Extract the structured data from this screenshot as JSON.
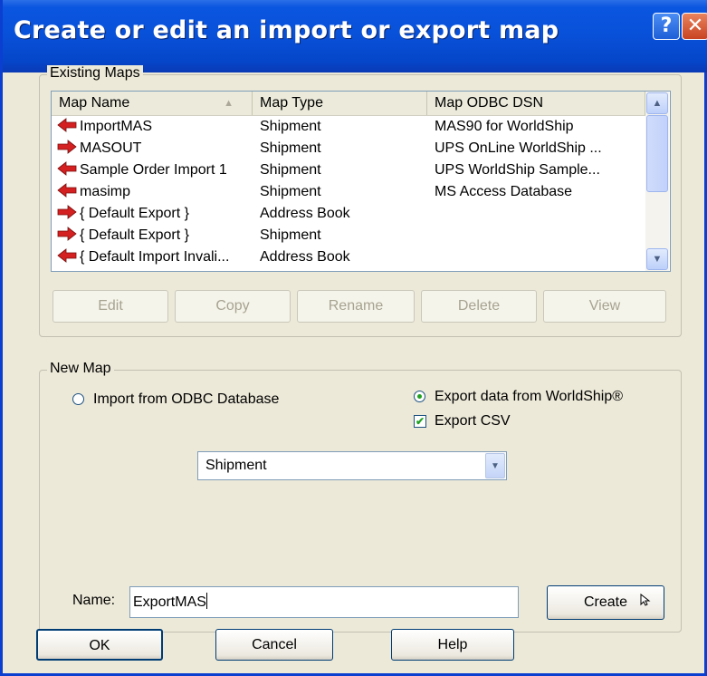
{
  "window": {
    "title": "Create or edit an import or export map",
    "help_glyph": "?",
    "close_glyph": "✕"
  },
  "existing_maps": {
    "legend": "Existing Maps",
    "columns": [
      "Map Name",
      "Map Type",
      "Map ODBC DSN"
    ],
    "rows": [
      {
        "name": "ImportMAS",
        "type": "Shipment",
        "dsn": "MAS90 for WorldShip",
        "direction": "import"
      },
      {
        "name": "MASOUT",
        "type": "Shipment",
        "dsn": "UPS OnLine WorldShip ...",
        "direction": "export"
      },
      {
        "name": "Sample Order Import 1",
        "type": "Shipment",
        "dsn": "UPS WorldShip Sample...",
        "direction": "import"
      },
      {
        "name": "masimp",
        "type": "Shipment",
        "dsn": "MS Access Database",
        "direction": "import"
      },
      {
        "name": "{ Default Export }",
        "type": "Address Book",
        "dsn": "",
        "direction": "export"
      },
      {
        "name": "{ Default Export }",
        "type": "Shipment",
        "dsn": "",
        "direction": "export"
      },
      {
        "name": "{ Default Import Invali...",
        "type": "Address Book",
        "dsn": "",
        "direction": "import"
      }
    ],
    "buttons": {
      "edit": "Edit",
      "copy": "Copy",
      "rename": "Rename",
      "delete": "Delete",
      "view": "View"
    }
  },
  "new_map": {
    "legend": "New Map",
    "import_option": "Import from ODBC Database",
    "export_option": "Export data from WorldShip®",
    "export_csv": "Export CSV",
    "selected_option": "export",
    "export_csv_checked": true,
    "map_type_selected": "Shipment",
    "name_label": "Name:",
    "name_value": "ExportMAS",
    "create_button": "Create"
  },
  "footer": {
    "ok": "OK",
    "cancel": "Cancel",
    "help": "Help"
  },
  "colors": {
    "titlebar": "#0850d8",
    "dialog_bg": "#ece9d8",
    "import_arrow": "#d42020",
    "export_arrow": "#d42020"
  }
}
